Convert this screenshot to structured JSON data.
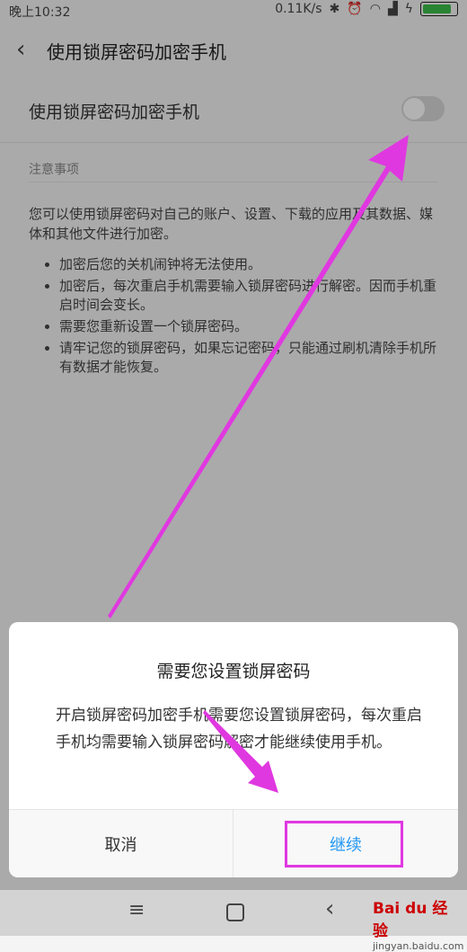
{
  "status_bar": {
    "time": "晚上10:32",
    "speed": "0.11K/s",
    "battery_level": 0.9
  },
  "app_bar": {
    "title": "使用锁屏密码加密手机"
  },
  "toggle_row": {
    "label": "使用锁屏密码加密手机",
    "enabled": false
  },
  "notes": {
    "heading": "注意事项",
    "intro": "您可以使用锁屏密码对自己的账户、设置、下载的应用及其数据、媒体和其他文件进行加密。",
    "bullets": [
      "加密后您的关机闹钟将无法使用。",
      "加密后，每次重启手机需要输入锁屏密码进行解密。因而手机重启时间会变长。",
      "需要您重新设置一个锁屏密码。",
      "请牢记您的锁屏密码，如果忘记密码，只能通过刷机清除手机所有数据才能恢复。"
    ]
  },
  "dialog": {
    "title": "需要您设置锁屏密码",
    "message": "开启锁屏密码加密手机需要您设置锁屏密码，每次重启手机均需要输入锁屏密码解密才能继续使用手机。",
    "cancel_label": "取消",
    "continue_label": "继续"
  },
  "watermark": {
    "brand": "Bai du 经验",
    "url": "jingyan.baidu.com"
  },
  "colors": {
    "accent": "#2196f3",
    "annotation": "#e038e0"
  }
}
